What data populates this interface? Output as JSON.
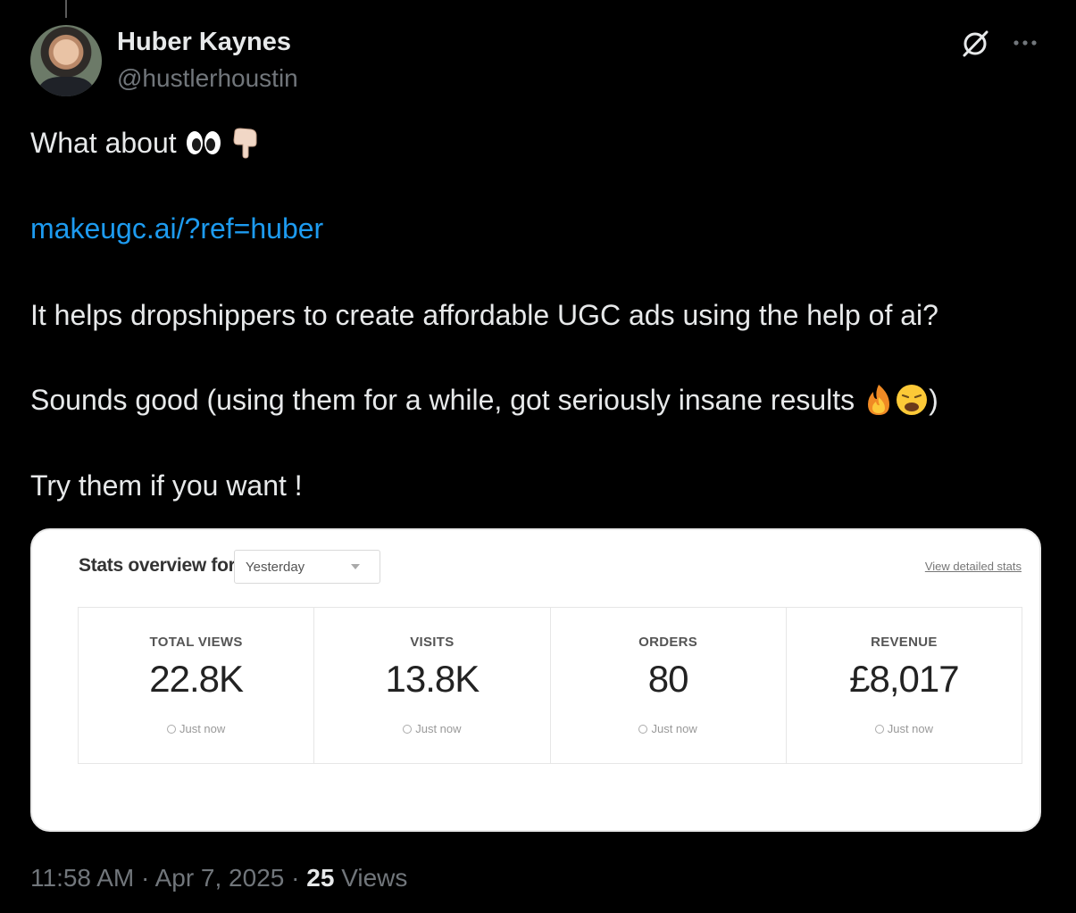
{
  "tweet": {
    "author_name": "Huber Kaynes",
    "author_handle": "@hustlerhoustin",
    "line1": "What about",
    "link": "makeugc.ai/?ref=huber",
    "line3": "It helps dropshippers to create affordable UGC ads  using the help of ai?",
    "line4": "Sounds good (using them for a while, got seriously insane results",
    "line4_close": ")",
    "line5": "Try them if you want !"
  },
  "icons": {
    "top_right": [
      "grok-icon",
      "more-icon"
    ],
    "inline_emoji": [
      "eyes-emoji",
      "pointing-down-emoji",
      "fire-emoji",
      "weary-face-emoji"
    ]
  },
  "card": {
    "title": "Stats overview for",
    "period": "Yesterday",
    "view_link": "View detailed stats",
    "stats": [
      {
        "label": "TOTAL VIEWS",
        "value": "22.8K",
        "time": "Just now"
      },
      {
        "label": "VISITS",
        "value": "13.8K",
        "time": "Just now"
      },
      {
        "label": "ORDERS",
        "value": "80",
        "time": "Just now"
      },
      {
        "label": "REVENUE",
        "value": "£8,017",
        "time": "Just now"
      }
    ]
  },
  "meta": {
    "time": "11:58 AM",
    "sep1": "·",
    "date": "Apr 7, 2025",
    "sep2": "·",
    "views_count": "25",
    "views_label": "Views"
  },
  "colors": {
    "background": "#000000",
    "text": "#e7e9ea",
    "muted": "#71767b",
    "link": "#1d9bf0"
  }
}
